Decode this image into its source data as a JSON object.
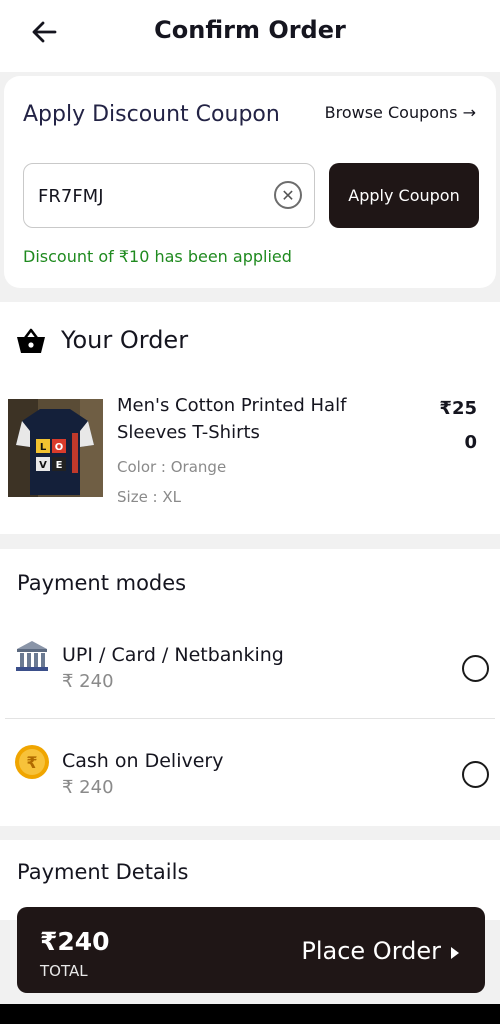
{
  "header": {
    "title": "Confirm Order",
    "back_icon": "arrow-left-icon"
  },
  "coupon": {
    "title": "Apply Discount Coupon",
    "browse_label": "Browse Coupons →",
    "input_value": "FR7FMJ",
    "apply_label": "Apply Coupon",
    "discount_message": "Discount of ₹10 has been applied",
    "message_color": "#1f8a1f"
  },
  "order": {
    "title": "Your Order",
    "icon": "basket-icon",
    "product": {
      "name": "Men's Cotton Printed Half Sleeves T-Shirts",
      "price": "₹250",
      "color": "Color : Orange",
      "size": "Size : XL",
      "image_icon": "tshirt-image"
    }
  },
  "payment": {
    "title": "Payment modes",
    "options": [
      {
        "label": "UPI / Card / Netbanking",
        "amount": "₹ 240",
        "icon": "bank-icon",
        "selected": false
      },
      {
        "label": "Cash on Delivery",
        "amount": "₹ 240",
        "icon": "rupee-coin-icon",
        "selected": false
      }
    ]
  },
  "details": {
    "title": "Payment Details"
  },
  "footer": {
    "total_amount": "₹240",
    "total_label": "TOTAL",
    "place_label": "Place Order",
    "accent": "#1f1616"
  }
}
